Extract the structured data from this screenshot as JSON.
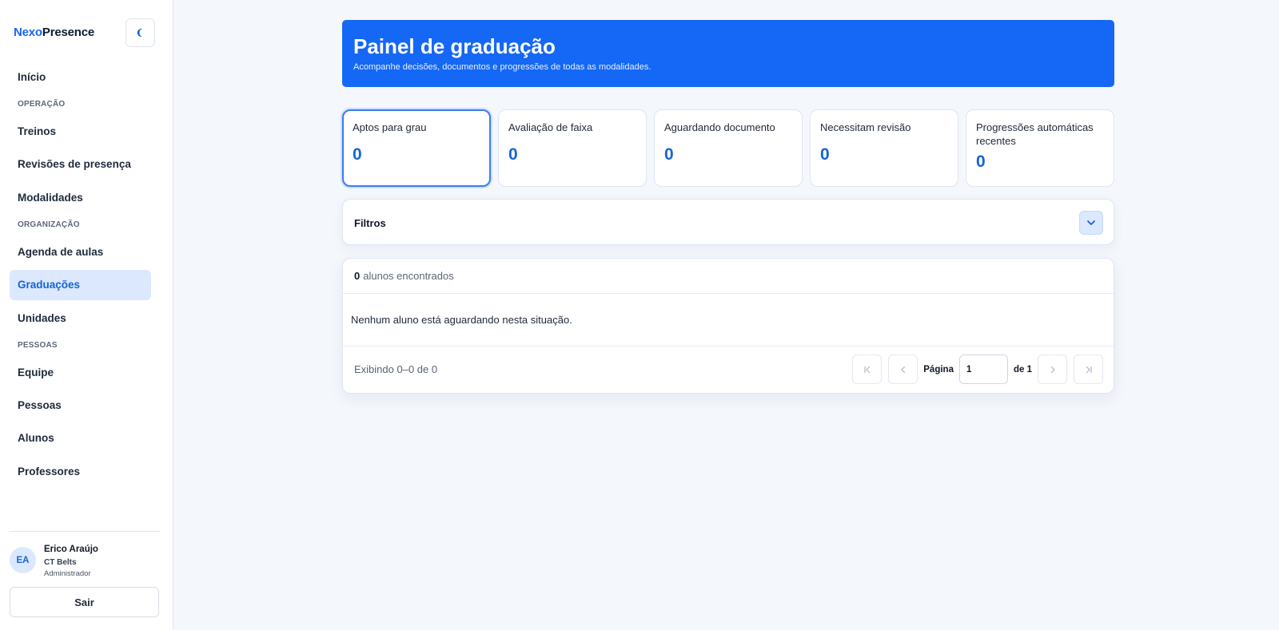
{
  "brand": {
    "part1": "Nexo",
    "part2": "Presence"
  },
  "theme_toggle": {
    "icon": "moon-icon"
  },
  "sidebar": {
    "home": "Início",
    "sections": [
      {
        "title": "OPERAÇÃO",
        "items": [
          "Treinos",
          "Revisões de presença",
          "Modalidades"
        ]
      },
      {
        "title": "ORGANIZAÇÃO",
        "items": [
          "Agenda de aulas",
          "Graduações",
          "Unidades"
        ]
      },
      {
        "title": "PESSOAS",
        "items": [
          "Equipe",
          "Pessoas",
          "Alunos",
          "Professores"
        ]
      }
    ],
    "active_item": "Graduações"
  },
  "user": {
    "initials": "EA",
    "name": "Erico Araújo",
    "org": "CT Belts",
    "role": "Administrador"
  },
  "logout_label": "Sair",
  "hero": {
    "title": "Painel de graduação",
    "subtitle": "Acompanhe decisões, documentos e progressões de todas as modalidades."
  },
  "stats": [
    {
      "label": "Aptos para grau",
      "value": "0"
    },
    {
      "label": "Avaliação de faixa",
      "value": "0"
    },
    {
      "label": "Aguardando documento",
      "value": "0"
    },
    {
      "label": "Necessitam revisão",
      "value": "0"
    },
    {
      "label": "Progressões automáticas recentes",
      "value": "0"
    }
  ],
  "filters": {
    "title": "Filtros"
  },
  "results": {
    "count": "0",
    "count_label": "alunos encontrados",
    "empty_message": "Nenhum aluno está aguardando nesta situação.",
    "showing": "Exibindo 0–0 de 0"
  },
  "pagination": {
    "page_label": "Página",
    "current_page": "1",
    "of_label": "de 1"
  },
  "colors": {
    "accent": "#1568f5",
    "active_bg": "#dbe8fd",
    "page_bg": "#f4f7fc"
  }
}
